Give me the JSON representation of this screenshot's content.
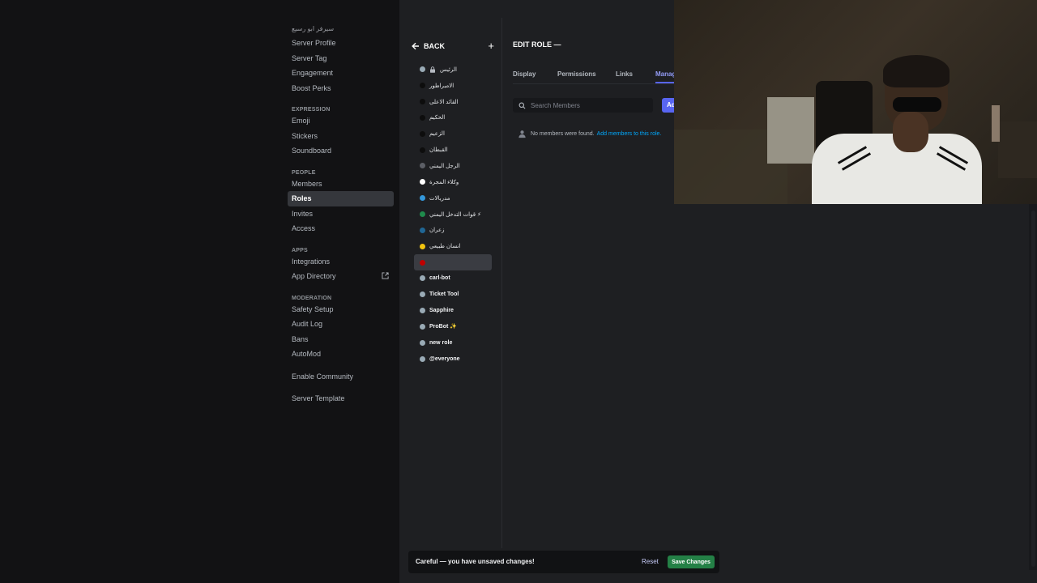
{
  "sidebar": {
    "server_name": "سيرفر ابو رسيع",
    "items_top": [
      {
        "label": "Server Profile"
      },
      {
        "label": "Server Tag"
      },
      {
        "label": "Engagement"
      },
      {
        "label": "Boost Perks"
      }
    ],
    "expression": {
      "title": "EXPRESSION",
      "items": [
        {
          "label": "Emoji"
        },
        {
          "label": "Stickers"
        },
        {
          "label": "Soundboard"
        }
      ]
    },
    "people": {
      "title": "PEOPLE",
      "items": [
        {
          "label": "Members"
        },
        {
          "label": "Roles"
        },
        {
          "label": "Invites"
        },
        {
          "label": "Access"
        }
      ]
    },
    "apps": {
      "title": "APPS",
      "items": [
        {
          "label": "Integrations"
        },
        {
          "label": "App Directory"
        }
      ]
    },
    "moderation": {
      "title": "MODERATION",
      "items": [
        {
          "label": "Safety Setup"
        },
        {
          "label": "Audit Log"
        },
        {
          "label": "Bans"
        },
        {
          "label": "AutoMod"
        }
      ]
    },
    "enable_community": "Enable Community",
    "server_template": "Server Template"
  },
  "roles_panel": {
    "back_label": "BACK",
    "add_icon": "+",
    "roles": [
      {
        "name": "الرئيس",
        "color": "#99aab5",
        "locked": true
      },
      {
        "name": "الامبراطور",
        "color": "#0d0d0d"
      },
      {
        "name": "القائد الاعلى",
        "color": "#0d0d0d"
      },
      {
        "name": "الحكيم",
        "color": "#0d0d0d"
      },
      {
        "name": "الزعيم",
        "color": "#0d0d0d"
      },
      {
        "name": "القبطان",
        "color": "#0d0d0d"
      },
      {
        "name": "الرجل اليمني",
        "color": "#5c5f66"
      },
      {
        "name": "وكلاء المجرة",
        "color": "#ffffff"
      },
      {
        "name": "مدريالات",
        "color": "#3498db"
      },
      {
        "name": "قوات التدخل اليمني ⚡",
        "color": "#1f8b4c"
      },
      {
        "name": "زعران",
        "color": "#206694"
      },
      {
        "name": "انسان طبيعي",
        "color": "#f1c40f"
      },
      {
        "name": "",
        "color": "#c00000",
        "selected": true
      },
      {
        "name": "carl-bot",
        "color": "#99aab5",
        "bold": true
      },
      {
        "name": "Ticket Tool",
        "color": "#99aab5",
        "bold": true
      },
      {
        "name": "Sapphire",
        "color": "#99aab5",
        "bold": true
      },
      {
        "name": "ProBot ✨",
        "color": "#99aab5",
        "bold": true
      },
      {
        "name": "new role",
        "color": "#99aab5",
        "bold": true
      },
      {
        "name": "@everyone",
        "color": "#99aab5",
        "bold": true
      }
    ]
  },
  "edit_role": {
    "title": "EDIT ROLE —",
    "tabs": [
      {
        "label": "Display"
      },
      {
        "label": "Permissions"
      },
      {
        "label": "Links"
      },
      {
        "label": "Manag",
        "active": true
      }
    ],
    "search_placeholder": "Search Members",
    "add_members_label": "Ad",
    "empty_text": "No members were found.",
    "empty_link": "Add members to this role."
  },
  "notice": {
    "text": "Careful — you have unsaved changes!",
    "reset_label": "Reset",
    "save_label": "Save Changes"
  },
  "colors": {
    "accent": "#5865f2",
    "success": "#248046",
    "link": "#00a8fc"
  }
}
